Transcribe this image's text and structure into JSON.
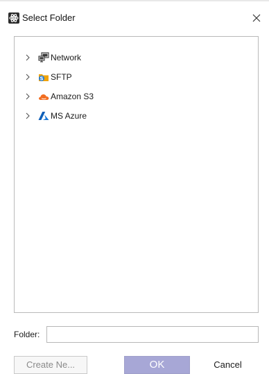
{
  "dialog": {
    "title": "Select Folder"
  },
  "tree": {
    "items": [
      {
        "label": "Network",
        "icon": "network-icon"
      },
      {
        "label": "SFTP",
        "icon": "sftp-icon"
      },
      {
        "label": "Amazon S3",
        "icon": "amazon-s3-icon"
      },
      {
        "label": "MS Azure",
        "icon": "ms-azure-icon"
      }
    ]
  },
  "folder": {
    "label": "Folder:",
    "value": ""
  },
  "buttons": {
    "create_label": "Create Ne...",
    "ok_label": "OK",
    "cancel_label": "Cancel"
  },
  "colors": {
    "ok_button_bg": "#a7a7d6",
    "amazon_orange": "#f26e21",
    "azure_blue": "#0f5fb8",
    "sftp_orange": "#f0a30a",
    "sftp_blue": "#2a7fd4"
  }
}
